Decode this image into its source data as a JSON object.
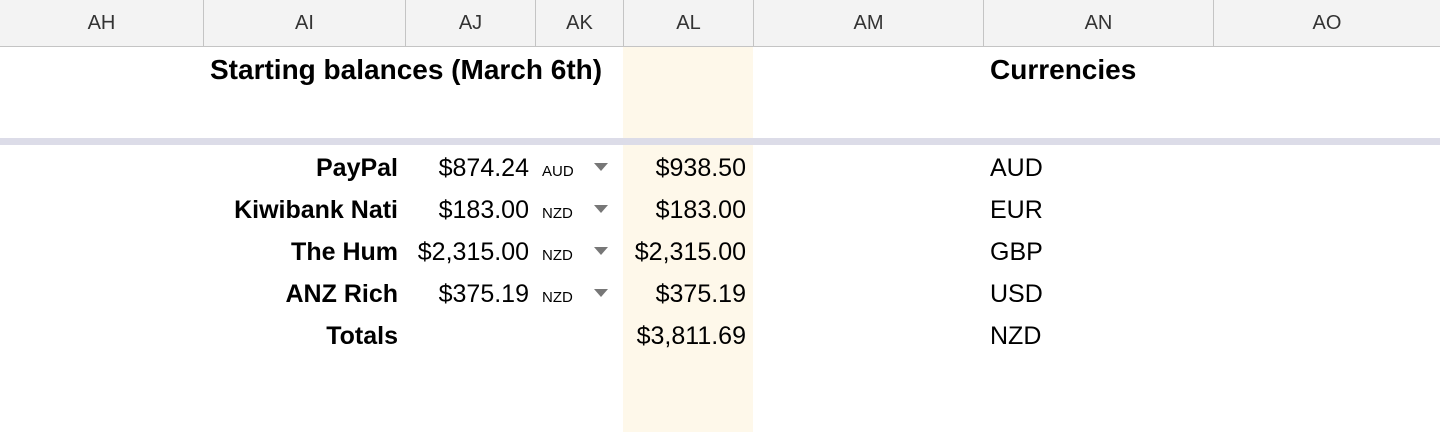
{
  "columns": [
    "AH",
    "AI",
    "AJ",
    "AK",
    "AL",
    "AM",
    "AN",
    "AO"
  ],
  "highlight_color": "#fef8ea",
  "balances": {
    "title": "Starting balances (March 6th)",
    "rows": [
      {
        "label": "PayPal",
        "amount": "$874.24",
        "currency": "AUD",
        "converted": "$938.50"
      },
      {
        "label": "Kiwibank Nati",
        "amount": "$183.00",
        "currency": "NZD",
        "converted": "$183.00"
      },
      {
        "label": "The Hum",
        "amount": "$2,315.00",
        "currency": "NZD",
        "converted": "$2,315.00"
      },
      {
        "label": "ANZ Rich",
        "amount": "$375.19",
        "currency": "NZD",
        "converted": "$375.19"
      }
    ],
    "totals_label": "Totals",
    "totals_value": "$3,811.69"
  },
  "currencies": {
    "title": "Currencies",
    "items": [
      "AUD",
      "EUR",
      "GBP",
      "USD",
      "NZD"
    ]
  }
}
